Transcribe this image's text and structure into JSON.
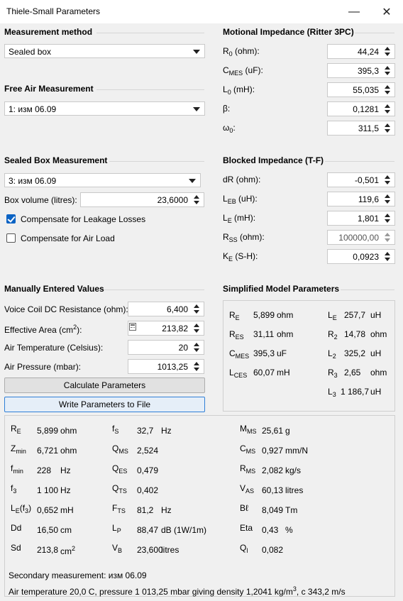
{
  "window": {
    "title": "Thiele-Small Parameters",
    "minimize": "—",
    "close": "✕"
  },
  "measurement_method": {
    "header": "Measurement method",
    "value": "Sealed box"
  },
  "free_air": {
    "header": "Free Air Measurement",
    "value": "1: изм 06.09"
  },
  "sealed_box": {
    "header": "Sealed Box Measurement",
    "value": "3: изм 06.09",
    "box_volume_label": "Box volume (litres):",
    "box_volume": "23,6000",
    "leakage_label": "Compensate for Leakage Losses",
    "leakage_checked": true,
    "airload_label": "Compensate for Air Load",
    "airload_checked": false
  },
  "motional": {
    "header": "Motional Impedance (Ritter 3PC)",
    "rows": [
      {
        "sym": "R",
        "sub": "0",
        "unit": " (ohm):",
        "value": "44,24"
      },
      {
        "sym": "C",
        "sub": "MES",
        "unit": " (uF):",
        "value": "395,3"
      },
      {
        "sym": "L",
        "sub": "0",
        "unit": " (mH):",
        "value": "55,035"
      },
      {
        "sym": "β:",
        "sub": "",
        "unit": "",
        "value": "0,1281"
      },
      {
        "sym": "ω",
        "sub": "0",
        "unit": ":",
        "value": "311,5"
      }
    ]
  },
  "blocked": {
    "header": "Blocked Impedance (T-F)",
    "rows": [
      {
        "sym": "dR (ohm):",
        "sub": "",
        "unit": "",
        "value": "-0,501"
      },
      {
        "sym": "L",
        "sub": "EB",
        "unit": " (uH):",
        "value": "119,6"
      },
      {
        "sym": "L",
        "sub": "E",
        "unit": " (mH):",
        "value": "1,801"
      },
      {
        "sym": "R",
        "sub": "SS",
        "unit": " (ohm):",
        "value": "100000,00"
      },
      {
        "sym": "K",
        "sub": "E",
        "unit": " (S-H):",
        "value": "0,0923"
      }
    ]
  },
  "manual": {
    "header": "Manually Entered Values",
    "voice_coil_label": "Voice Coil DC Resistance (ohm):",
    "voice_coil": "6,400",
    "area_label": "Effective Area (cm",
    "area_sup": "2",
    "area_label_end": "):",
    "area": "213,82",
    "temp_label": "Air Temperature (Celsius):",
    "temp": "20",
    "pressure_label": "Air Pressure (mbar):",
    "pressure": "1013,25"
  },
  "buttons": {
    "calculate": "Calculate Parameters",
    "write": "Write Parameters to File"
  },
  "simplified": {
    "header": "Simplified Model Parameters",
    "left": [
      {
        "sym": "R",
        "sub": "E",
        "value": "5,899",
        "unit": "ohm"
      },
      {
        "sym": "R",
        "sub": "ES",
        "value": "31,11",
        "unit": "ohm"
      },
      {
        "sym": "C",
        "sub": "MES",
        "value": "395,3",
        "unit": "uF"
      },
      {
        "sym": "L",
        "sub": "CES",
        "value": "60,07",
        "unit": "mH"
      }
    ],
    "right": [
      {
        "sym": "L",
        "sub": "E",
        "value": "257,7",
        "unit": "uH"
      },
      {
        "sym": "R",
        "sub": "2",
        "value": "14,78",
        "unit": "ohm"
      },
      {
        "sym": "L",
        "sub": "2",
        "value": "325,2",
        "unit": "uH"
      },
      {
        "sym": "R",
        "sub": "3",
        "value": "2,65",
        "unit": "ohm"
      },
      {
        "sym": "L",
        "sub": "3",
        "value": "1 186,7",
        "unit": "uH"
      }
    ]
  },
  "results": {
    "col1": [
      {
        "sym": "R",
        "sub": "E",
        "value": "5,899",
        "unit": "ohm"
      },
      {
        "sym": "Z",
        "sub": "min",
        "value": "6,721",
        "unit": "ohm"
      },
      {
        "sym": "f",
        "sub": "min",
        "value": "228",
        "unit": "Hz"
      },
      {
        "sym": "f",
        "sub": "3",
        "value": "1 100",
        "unit": "Hz"
      },
      {
        "sym": "L",
        "sub": "E",
        "extra": "(f",
        "extra_sub": "3",
        "extra_end": ")",
        "value": "0,652",
        "unit": "mH"
      },
      {
        "sym": "Dd",
        "sub": "",
        "value": "16,50",
        "unit": "cm"
      },
      {
        "sym": "Sd",
        "sub": "",
        "value": "213,8",
        "unit": "cm",
        "unit_sup": "2"
      }
    ],
    "col2": [
      {
        "sym": "f",
        "sub": "S",
        "value": "32,7",
        "unit": "Hz"
      },
      {
        "sym": "Q",
        "sub": "MS",
        "value": "2,524",
        "unit": ""
      },
      {
        "sym": "Q",
        "sub": "ES",
        "value": "0,479",
        "unit": ""
      },
      {
        "sym": "Q",
        "sub": "TS",
        "value": "0,402",
        "unit": ""
      },
      {
        "sym": "F",
        "sub": "TS",
        "value": "81,2",
        "unit": "Hz"
      },
      {
        "sym": "L",
        "sub": "P",
        "value": "88,47",
        "unit": "dB (1W/1m)"
      },
      {
        "sym": "V",
        "sub": "B",
        "value": "23,600",
        "unit": "litres"
      }
    ],
    "col3": [
      {
        "sym": "M",
        "sub": "MS",
        "value": "25,61",
        "unit": "g"
      },
      {
        "sym": "C",
        "sub": "MS",
        "value": "0,927",
        "unit": "mm/N"
      },
      {
        "sym": "R",
        "sub": "MS",
        "value": "2,082",
        "unit": "kg/s"
      },
      {
        "sym": "V",
        "sub": "AS",
        "value": "60,13",
        "unit": "litres"
      },
      {
        "sym": "Bℓ",
        "sub": "",
        "value": "8,049",
        "unit": "Tm"
      },
      {
        "sym": "Eta",
        "sub": "",
        "value": "0,43",
        "unit": "%"
      },
      {
        "sym": "Q",
        "sub": "l",
        "value": "0,082",
        "unit": ""
      }
    ],
    "secondary": "Secondary measurement: изм 06.09",
    "air": "Air temperature 20,0 C, pressure 1 013,25 mbar giving density 1,2041 kg/m",
    "air_sup": "3",
    "air_end": ", c 343,2 m/s"
  }
}
